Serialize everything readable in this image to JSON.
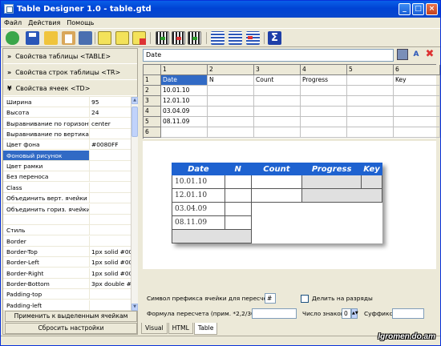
{
  "window": {
    "title": "Table Designer 1.0 - table.gtd",
    "minimize_glyph": "_",
    "maximize_glyph": "□",
    "close_glyph": "×"
  },
  "menu": [
    "Файл",
    "Действия",
    "Помощь"
  ],
  "toolbar": {
    "icons": [
      "refresh-icon",
      "save-icon",
      "open-folder-icon",
      "paste-icon",
      "tools-icon",
      "list-icon",
      "checklist-icon",
      "clear-icon",
      "insert-column-icon",
      "delete-column-icon",
      "column-props-icon",
      "align-left-icon",
      "align-center-icon",
      "align-right-icon",
      "sum-icon"
    ]
  },
  "sections": {
    "table": "Свойства таблицы <TABLE>",
    "rows": "Свойства строк таблицы <TR>",
    "cells": "Свойства ячеек <TD>",
    "chevron_collapsed": "»",
    "chevron_expanded": "¥"
  },
  "properties": [
    {
      "name": "Ширина",
      "value": "95"
    },
    {
      "name": "Высота",
      "value": "24"
    },
    {
      "name": "Выравнивание по горизонтали",
      "value": "center"
    },
    {
      "name": "Выравнивание по вертикали",
      "value": ""
    },
    {
      "name": "Цвет фона",
      "value": "#0080FF"
    },
    {
      "name": "Фоновый рисунок",
      "value": ""
    },
    {
      "name": "Цвет рамки",
      "value": ""
    },
    {
      "name": "Без переноса",
      "value": ""
    },
    {
      "name": "Class",
      "value": ""
    },
    {
      "name": "Объединить верт. ячейки",
      "value": ""
    },
    {
      "name": "Объединить гориз. ячейки",
      "value": ""
    },
    {
      "name": "",
      "value": ""
    },
    {
      "name": "   Стиль",
      "value": ""
    },
    {
      "name": "Border",
      "value": ""
    },
    {
      "name": "Border-Top",
      "value": "1px solid #00"
    },
    {
      "name": "Border-Left",
      "value": "1px solid #00"
    },
    {
      "name": "Border-Right",
      "value": "1px solid #00"
    },
    {
      "name": "Border-Bottom",
      "value": "3px double #"
    },
    {
      "name": "Padding-top",
      "value": ""
    },
    {
      "name": "Padding-left",
      "value": ""
    }
  ],
  "selected_property_index": 5,
  "buttons": {
    "apply": "Применить к выделенным ячейкам",
    "reset": "Сбросить настройки"
  },
  "formula_bar": {
    "value": "Date"
  },
  "grid": {
    "col_headers": [
      "1",
      "2",
      "3",
      "4",
      "5",
      "6"
    ],
    "row_headers": [
      "1",
      "2",
      "3",
      "4",
      "5",
      "6"
    ],
    "rows": [
      [
        "Date",
        "N",
        "Count",
        "Progress",
        "",
        "Key"
      ],
      [
        "10.01.10",
        "",
        "",
        "",
        "",
        ""
      ],
      [
        "12.01.10",
        "",
        "",
        "",
        "",
        ""
      ],
      [
        "03.04.09",
        "",
        "",
        "",
        "",
        ""
      ],
      [
        "08.11.09",
        "",
        "",
        "",
        "",
        ""
      ],
      [
        "",
        "",
        "",
        "",
        "",
        ""
      ]
    ]
  },
  "preview_table": {
    "headers": [
      "Date",
      "N",
      "Count",
      "Progress",
      "Key"
    ],
    "rows": [
      [
        "10.01.10",
        "",
        "",
        "",
        "",
        ""
      ],
      [
        "12.01.10",
        "",
        "",
        ""
      ],
      [
        "03.04.09",
        ""
      ],
      [
        "08.11.09",
        ""
      ],
      [
        ""
      ]
    ],
    "header_color": "#1e62d0"
  },
  "bottom": {
    "prefix_label": "Символ префикса ячейки для пересчета",
    "prefix_value": "#",
    "split_label": "Делить на разряды",
    "formula_label": "Формула пересчета (прим. *2,2/30)",
    "formula_value": "",
    "digits_label": "Число знаков",
    "digits_value": "0",
    "suffix_label": "Суффикс",
    "suffix_value": ""
  },
  "tabs": [
    "Visual",
    "HTML",
    "Table"
  ],
  "active_tab": 2,
  "watermark": "Igromen.do.am"
}
